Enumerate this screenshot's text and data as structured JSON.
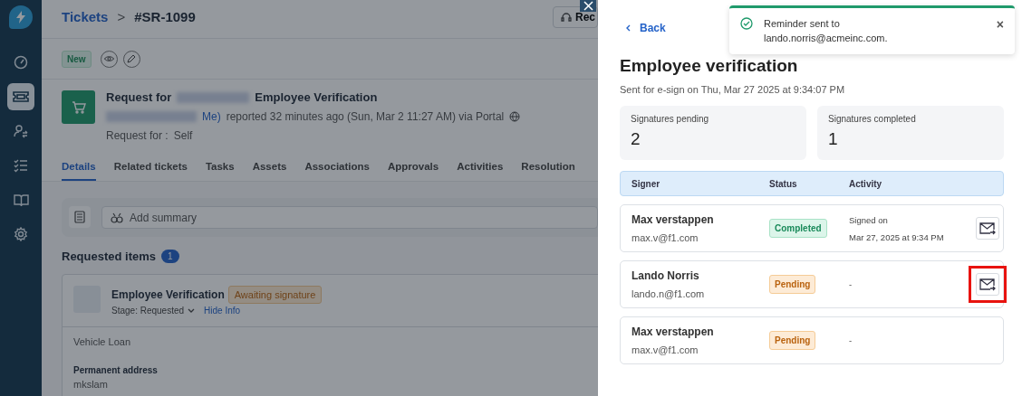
{
  "sidebar": {
    "items": [
      {
        "selected": false
      },
      {
        "selected": true
      },
      {
        "selected": false
      },
      {
        "selected": false
      },
      {
        "selected": false
      },
      {
        "selected": false
      }
    ]
  },
  "breadcrumb": {
    "parent": "Tickets",
    "separator": ">",
    "current": "#SR-1099"
  },
  "header_button": "Rec",
  "status_badge": "New",
  "ticket": {
    "title_prefix": "Request for",
    "title_suffix": "Employee Verification",
    "requester_suffix": "Me)",
    "reported": "reported 32 minutes ago (Sun, Mar 2 11:27 AM) via Portal",
    "request_for_label": "Request for :",
    "request_for_value": "Self"
  },
  "tabs": [
    {
      "label": "Details",
      "selected": true
    },
    {
      "label": "Related tickets",
      "selected": false
    },
    {
      "label": "Tasks",
      "selected": false
    },
    {
      "label": "Assets",
      "selected": false
    },
    {
      "label": "Associations",
      "selected": false
    },
    {
      "label": "Approvals",
      "selected": false
    },
    {
      "label": "Activities",
      "selected": false
    },
    {
      "label": "Resolution",
      "selected": false
    }
  ],
  "summary": {
    "placeholder": "Add summary"
  },
  "requested_items": {
    "title": "Requested items",
    "count": "1",
    "item": {
      "name": "Employee Verification",
      "status": "Awaiting signature",
      "stage_label": "Stage:",
      "stage": "Requested",
      "hide_info": "Hide Info",
      "description": "Vehicle Loan",
      "field_label": "Permanent address",
      "field_value": "mkslam"
    }
  },
  "drawer": {
    "back": "Back",
    "title": "Employee verification",
    "subtitle": "Sent for e-sign on Thu, Mar 27 2025 at 9:34:07 PM",
    "stats": [
      {
        "label": "Signatures pending",
        "value": "2"
      },
      {
        "label": "Signatures completed",
        "value": "1"
      }
    ],
    "columns": [
      "Signer",
      "Status",
      "Activity"
    ],
    "signers": [
      {
        "name": "Max verstappen",
        "email": "max.v@f1.com",
        "status": "Completed",
        "kind": "completed",
        "activity": [
          "Signed on",
          "Mar 27, 2025 at 9:34 PM"
        ],
        "resend_button": true,
        "highlighted": false
      },
      {
        "name": "Lando Norris",
        "email": "lando.n@f1.com",
        "status": "Pending",
        "kind": "pending",
        "activity": [
          "-"
        ],
        "resend_button": true,
        "highlighted": true
      },
      {
        "name": "Max verstappen",
        "email": "max.v@f1.com",
        "status": "Pending",
        "kind": "pending",
        "activity": [
          "-"
        ],
        "resend_button": false,
        "highlighted": false
      }
    ]
  },
  "toast": {
    "lines": [
      "Reminder sent to",
      "lando.norris@acmeinc.com."
    ],
    "close": "×"
  }
}
